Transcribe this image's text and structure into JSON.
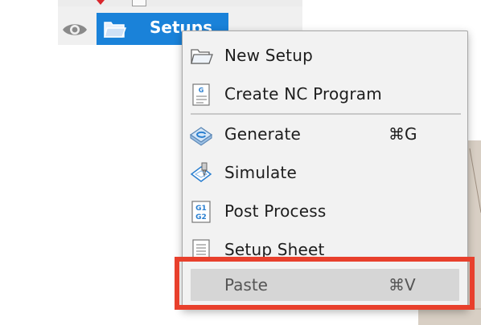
{
  "browser": {
    "setups_label": "Setups"
  },
  "context_menu": {
    "items": [
      {
        "label": "New Setup",
        "icon": "folder-open-icon",
        "shortcut": ""
      },
      {
        "label": "Create NC Program",
        "icon": "nc-program-icon",
        "shortcut": ""
      },
      {
        "label": "Generate",
        "icon": "generate-icon",
        "shortcut": "⌘G"
      },
      {
        "label": "Simulate",
        "icon": "simulate-icon",
        "shortcut": ""
      },
      {
        "label": "Post Process",
        "icon": "post-process-icon",
        "shortcut": ""
      },
      {
        "label": "Setup Sheet",
        "icon": "setup-sheet-icon",
        "shortcut": ""
      },
      {
        "label": "Paste",
        "icon": "",
        "shortcut": "⌘V",
        "state": "disabled"
      }
    ]
  },
  "icon_glyphs": {
    "nc_program": "G",
    "post_process_top": "G1",
    "post_process_bottom": "G2"
  },
  "colors": {
    "selection_blue": "#1a82d9",
    "highlight_red": "#e8402c",
    "menu_bg": "#f2f2f2",
    "disabled_row_bg": "#d6d6d6",
    "icon_blue": "#2a7fd0"
  }
}
